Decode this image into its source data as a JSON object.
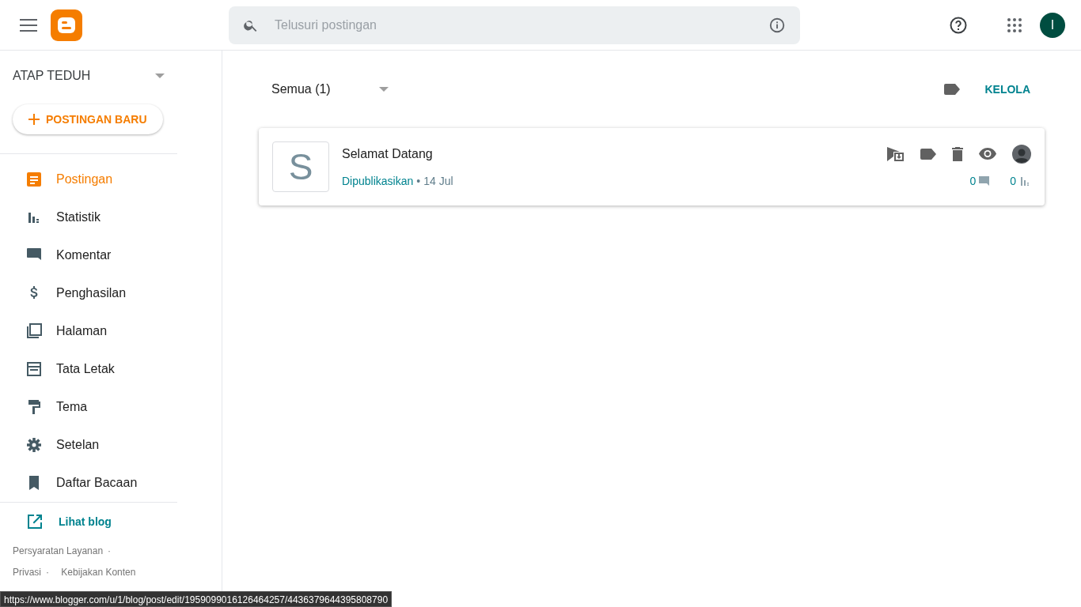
{
  "search": {
    "placeholder": "Telusuri postingan"
  },
  "avatar": {
    "initial": "I"
  },
  "blog": {
    "title": "ATAP TEDUH"
  },
  "new_post": {
    "label": "POSTINGAN BARU"
  },
  "nav": [
    {
      "label": "Postingan",
      "selected": true
    },
    {
      "label": "Statistik",
      "selected": false
    },
    {
      "label": "Komentar",
      "selected": false
    },
    {
      "label": "Penghasilan",
      "selected": false
    },
    {
      "label": "Halaman",
      "selected": false
    },
    {
      "label": "Tata Letak",
      "selected": false
    },
    {
      "label": "Tema",
      "selected": false
    },
    {
      "label": "Setelan",
      "selected": false
    },
    {
      "label": "Daftar Bacaan",
      "selected": false
    }
  ],
  "view_blog": {
    "label": "Lihat blog"
  },
  "footer_links": [
    "Persyaratan Layanan",
    "Privasi",
    "Kebijakan Konten"
  ],
  "footer_separator": "·",
  "filter": {
    "label": "Semua (1)"
  },
  "manage": {
    "label": "KELOLA"
  },
  "posts": [
    {
      "thumb": "S",
      "title": "Selamat Datang",
      "status": "Dipublikasikan",
      "separator": "•",
      "date": "14 Jul",
      "comments": "0",
      "views": "0"
    }
  ],
  "status_url": "https://www.blogger.com/u/1/blog/post/edit/1959099016126464257/4436379644395808790"
}
